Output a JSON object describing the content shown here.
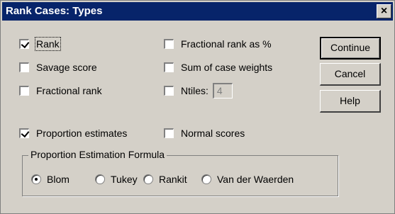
{
  "window": {
    "title": "Rank Cases: Types",
    "close_glyph": "✕"
  },
  "checkboxes": {
    "rank": {
      "label": "Rank",
      "checked": true
    },
    "savage_score": {
      "label": "Savage score",
      "checked": false
    },
    "fractional_rank": {
      "label": "Fractional rank",
      "checked": false
    },
    "fractional_rank_pct": {
      "label": "Fractional rank as %",
      "checked": false
    },
    "sum_case_weights": {
      "label": "Sum of case weights",
      "checked": false
    },
    "ntiles": {
      "label": "Ntiles:",
      "checked": false,
      "value": "4"
    },
    "proportion_estimates": {
      "label": "Proportion estimates",
      "checked": true
    },
    "normal_scores": {
      "label": "Normal scores",
      "checked": false
    }
  },
  "buttons": {
    "continue": "Continue",
    "cancel": "Cancel",
    "help": "Help"
  },
  "formula_group": {
    "caption": "Proportion Estimation Formula",
    "options": [
      {
        "label": "Blom",
        "selected": true
      },
      {
        "label": "Tukey",
        "selected": false
      },
      {
        "label": "Rankit",
        "selected": false
      },
      {
        "label": "Van der Waerden",
        "selected": false
      }
    ]
  }
}
